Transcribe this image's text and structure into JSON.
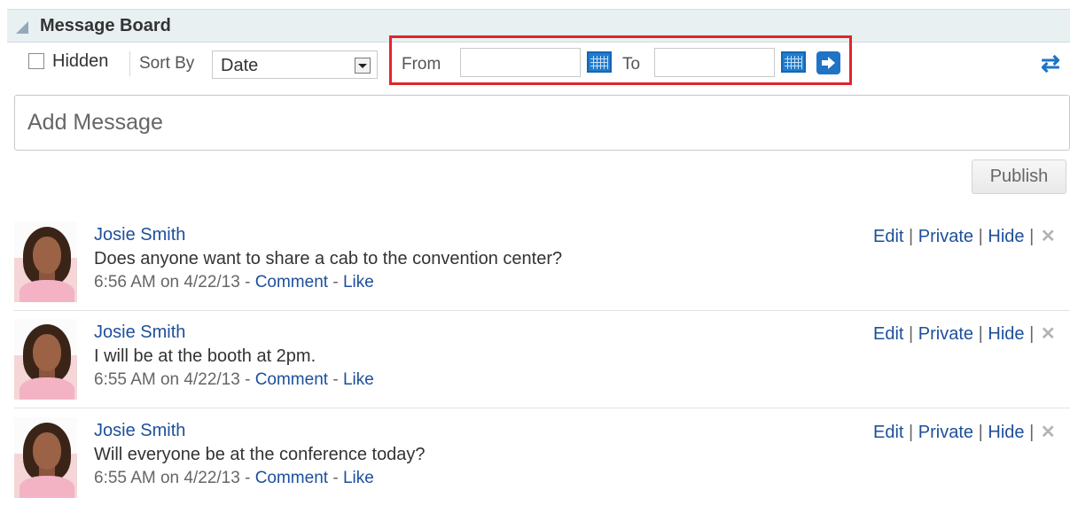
{
  "header": {
    "title": "Message Board"
  },
  "toolbar": {
    "hidden_label": "Hidden",
    "hidden_checked": false,
    "sort_by_label": "Sort By",
    "sort_value": "Date",
    "from_label": "From",
    "from_value": "",
    "to_label": "To",
    "to_value": ""
  },
  "composer": {
    "placeholder": "Add Message",
    "publish_label": "Publish"
  },
  "messages": [
    {
      "author": "Josie Smith",
      "text": "Does anyone want to share a cab to the convention center?",
      "timestamp": "6:56 AM on 4/22/13",
      "comment_label": "Comment",
      "like_label": "Like",
      "edit_label": "Edit",
      "private_label": "Private",
      "hide_label": "Hide"
    },
    {
      "author": "Josie Smith",
      "text": "I will be at the booth at 2pm.",
      "timestamp": "6:55 AM on 4/22/13",
      "comment_label": "Comment",
      "like_label": "Like",
      "edit_label": "Edit",
      "private_label": "Private",
      "hide_label": "Hide"
    },
    {
      "author": "Josie Smith",
      "text": "Will everyone be at the conference today?",
      "timestamp": "6:55 AM on 4/22/13",
      "comment_label": "Comment",
      "like_label": "Like",
      "edit_label": "Edit",
      "private_label": "Private",
      "hide_label": "Hide"
    }
  ],
  "separators": {
    "pipe": "|",
    "dash": "-"
  },
  "icons": {
    "collapse": "triangle-collapse-icon",
    "calendar": "calendar-icon",
    "go": "arrow-right-icon",
    "refresh": "refresh-icon",
    "delete": "close-x-icon"
  },
  "colors": {
    "link": "#1d4f9c",
    "highlight": "#e3242b",
    "header_bg": "#e8f0f2",
    "icon_blue": "#1f74c6"
  }
}
